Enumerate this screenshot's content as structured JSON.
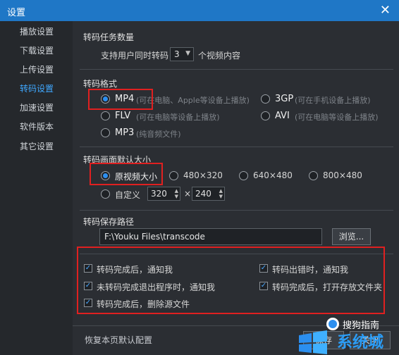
{
  "window": {
    "title": "设置",
    "close_icon": "close-icon"
  },
  "sidebar": {
    "items": [
      {
        "label": "播放设置",
        "active": false
      },
      {
        "label": "下载设置",
        "active": false
      },
      {
        "label": "上传设置",
        "active": false
      },
      {
        "label": "转码设置",
        "active": true
      },
      {
        "label": "加速设置",
        "active": false
      },
      {
        "label": "软件版本",
        "active": false
      },
      {
        "label": "其它设置",
        "active": false
      }
    ]
  },
  "task_count": {
    "title": "转码任务数量",
    "prefix": "支持用户同时转码",
    "value": "3",
    "suffix": "个视频内容"
  },
  "format": {
    "title": "转码格式",
    "options": [
      {
        "label": "MP4",
        "hint": "(可在电脑、Apple等设备上播放)",
        "selected": true
      },
      {
        "label": "3GP",
        "hint": "(可在手机设备上播放)",
        "selected": false
      },
      {
        "label": "FLV",
        "hint": "(可在电脑等设备上播放)",
        "selected": false
      },
      {
        "label": "AVI",
        "hint": "(可在电脑等设备上播放)",
        "selected": false
      },
      {
        "label": "MP3",
        "hint": "(纯音频文件)",
        "selected": false
      }
    ]
  },
  "size": {
    "title": "转码画面默认大小",
    "options": [
      {
        "label": "原视频大小",
        "selected": true
      },
      {
        "label": "480×320",
        "selected": false
      },
      {
        "label": "640×480",
        "selected": false
      },
      {
        "label": "800×480",
        "selected": false
      }
    ],
    "custom_label": "自定义",
    "width": "320",
    "times": "×",
    "height": "240"
  },
  "path": {
    "title": "转码保存路径",
    "value": "F:\\Youku Files\\transcode",
    "browse_label": "浏览..."
  },
  "notify": {
    "items": [
      {
        "label": "转码完成后，通知我",
        "checked": true
      },
      {
        "label": "转码出错时，通知我",
        "checked": true
      },
      {
        "label": "未转码完成退出程序时，通知我",
        "checked": true
      },
      {
        "label": "转码完成后，打开存放文件夹",
        "checked": true
      },
      {
        "label": "转码完成后，删除源文件",
        "checked": true
      }
    ]
  },
  "footer": {
    "restore_label": "恢复本页默认配置",
    "save_label": "保存",
    "close_label": "关闭"
  },
  "watermark": {
    "brand": "搜狗指南",
    "site": "系统城"
  },
  "colors": {
    "accent": "#1f77c6",
    "highlight": "#e02020",
    "active_text": "#3fa8ff"
  }
}
